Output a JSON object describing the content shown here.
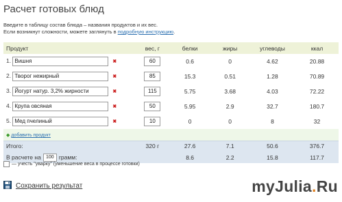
{
  "title": "Расчет готовых блюд",
  "intro": {
    "line1": "Введите в таблицу состав блюда – названия продуктов и их вес.",
    "line2_prefix": "Если возникнут сложности, можете заглянуть в ",
    "line2_link": "подробную инструкцию",
    "line2_suffix": "."
  },
  "headers": {
    "product": "Продукт",
    "weight": "вес, г",
    "protein": "белки",
    "fat": "жиры",
    "carbs": "углеводы",
    "kcal": "ккал"
  },
  "rows": [
    {
      "idx": "1.",
      "name": "Вишня",
      "weight": "60",
      "protein": "0.6",
      "fat": "0",
      "carbs": "4.62",
      "kcal": "20.88"
    },
    {
      "idx": "2.",
      "name": "Творог нежирный",
      "weight": "85",
      "protein": "15.3",
      "fat": "0.51",
      "carbs": "1.28",
      "kcal": "70.89"
    },
    {
      "idx": "3.",
      "name": "Йогурт натур. 3,2% жирности",
      "weight": "115",
      "protein": "5.75",
      "fat": "3.68",
      "carbs": "4.03",
      "kcal": "72.22"
    },
    {
      "idx": "4.",
      "name": "Крупа овсяная",
      "weight": "50",
      "protein": "5.95",
      "fat": "2.9",
      "carbs": "32.7",
      "kcal": "180.7"
    },
    {
      "idx": "5.",
      "name": "Мед пчелиный",
      "weight": "10",
      "protein": "0",
      "fat": "0",
      "carbs": "8",
      "kcal": "32"
    }
  ],
  "add_product": "добавить продукт",
  "total": {
    "label": "Итого:",
    "weight": "320 г",
    "protein": "27.6",
    "fat": "7.1",
    "carbs": "50.6",
    "kcal": "376.7"
  },
  "per": {
    "prefix": "В расчете на",
    "amount": "100",
    "suffix": "грамм:",
    "protein": "8.6",
    "fat": "2.2",
    "carbs": "15.8",
    "kcal": "117.7"
  },
  "boil_label": "— учесть \"уварку\" (уменьшение веса в процессе готовки)",
  "save_label": "Сохранить результат",
  "watermark": {
    "main": "myJulia",
    "dot": ".",
    "tld": "Ru"
  },
  "colors": {
    "link": "#2a6fb0",
    "delete": "#cc2020",
    "header_bg": "#eef2d8",
    "total_bg": "#dde6f0"
  }
}
